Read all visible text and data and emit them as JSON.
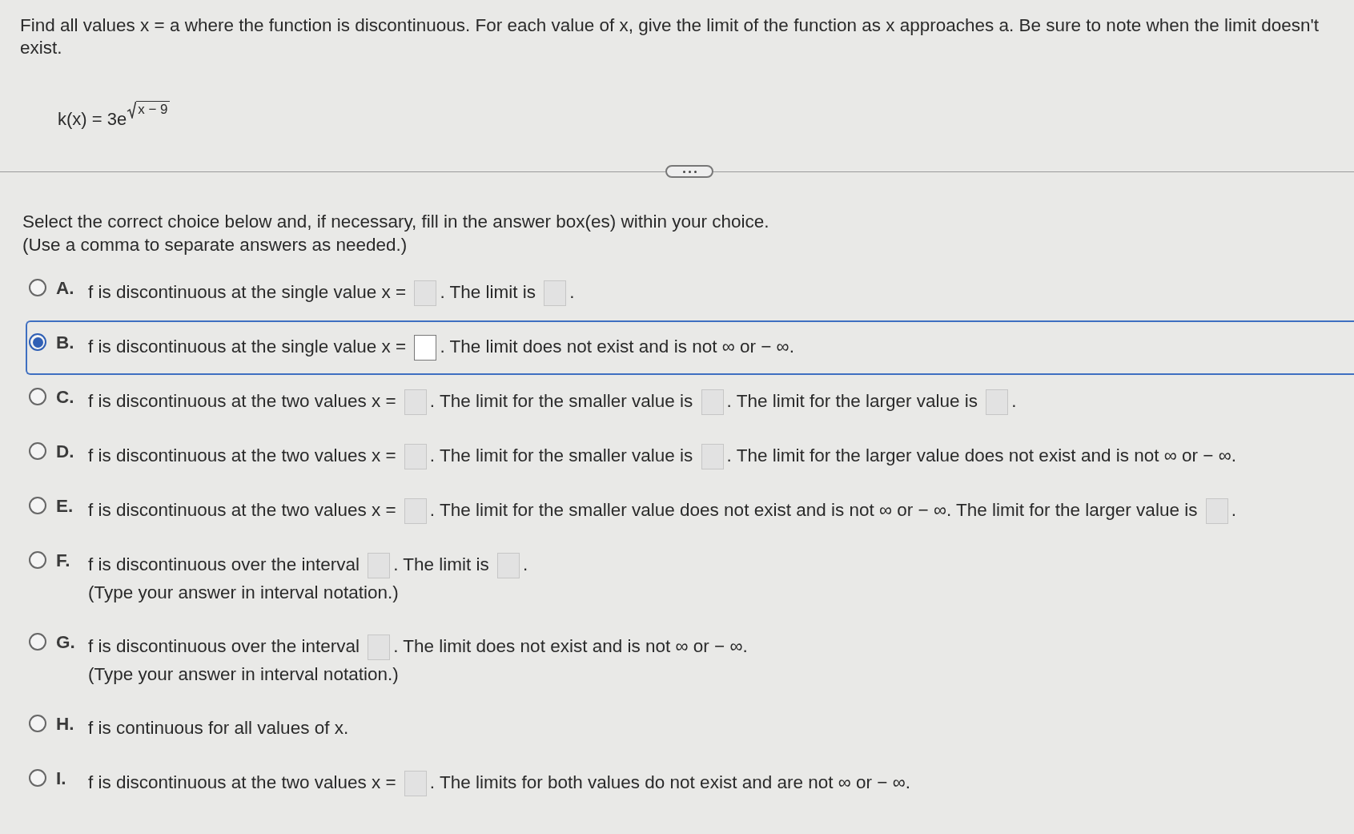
{
  "question": {
    "prompt": "Find all values x = a where the function is discontinuous. For each value of x, give the limit of the function as x approaches a. Be sure to note when the limit doesn't exist.",
    "formula": {
      "lhs": "k(x) = 3e",
      "radicand": "x − 9"
    }
  },
  "instructions": [
    "Select the correct choice below and, if necessary, fill in the answer box(es) within your choice.",
    "(Use a comma to separate answers as needed.)"
  ],
  "choices": [
    {
      "letter": "A.",
      "selected": false,
      "parts": [
        {
          "kind": "text",
          "text": "f is discontinuous at the single value x ="
        },
        {
          "kind": "box"
        },
        {
          "kind": "text",
          "text": ". The limit is"
        },
        {
          "kind": "box"
        },
        {
          "kind": "text",
          "text": "."
        }
      ]
    },
    {
      "letter": "B.",
      "selected": true,
      "parts": [
        {
          "kind": "text",
          "text": "f is discontinuous at the single value x ="
        },
        {
          "kind": "box"
        },
        {
          "kind": "text",
          "text": ". The limit does not exist and is not ∞ or − ∞."
        }
      ]
    },
    {
      "letter": "C.",
      "selected": false,
      "parts": [
        {
          "kind": "text",
          "text": "f is discontinuous at the two values x ="
        },
        {
          "kind": "box"
        },
        {
          "kind": "text",
          "text": ". The limit for the smaller value is"
        },
        {
          "kind": "box"
        },
        {
          "kind": "text",
          "text": ". The limit for the larger value is"
        },
        {
          "kind": "box"
        },
        {
          "kind": "text",
          "text": "."
        }
      ]
    },
    {
      "letter": "D.",
      "selected": false,
      "parts": [
        {
          "kind": "text",
          "text": "f is discontinuous at the two values x ="
        },
        {
          "kind": "box"
        },
        {
          "kind": "text",
          "text": ". The limit for the smaller value is"
        },
        {
          "kind": "box"
        },
        {
          "kind": "text",
          "text": ". The limit for the larger value does not exist and is not ∞ or"
        },
        {
          "kind": "text",
          "text": "− ∞."
        }
      ]
    },
    {
      "letter": "E.",
      "selected": false,
      "parts": [
        {
          "kind": "text",
          "text": "f is discontinuous at the two values x ="
        },
        {
          "kind": "box"
        },
        {
          "kind": "text",
          "text": ". The limit for the smaller value does not exist and is not ∞ or − ∞. The limit for the larger value is"
        },
        {
          "kind": "box"
        },
        {
          "kind": "text",
          "text": "."
        }
      ]
    },
    {
      "letter": "F.",
      "selected": false,
      "parts": [
        {
          "kind": "text",
          "text": "f is discontinuous over the interval"
        },
        {
          "kind": "box"
        },
        {
          "kind": "text",
          "text": ". The limit is"
        },
        {
          "kind": "box"
        },
        {
          "kind": "text",
          "text": "."
        }
      ],
      "note": "(Type your answer in interval notation.)"
    },
    {
      "letter": "G.",
      "selected": false,
      "parts": [
        {
          "kind": "text",
          "text": "f is discontinuous over the interval"
        },
        {
          "kind": "box"
        },
        {
          "kind": "text",
          "text": ". The limit does not exist and is not ∞ or − ∞."
        }
      ],
      "note": "(Type your answer in interval notation.)"
    },
    {
      "letter": "H.",
      "selected": false,
      "parts": [
        {
          "kind": "text",
          "text": "f is continuous for all values of x."
        }
      ]
    },
    {
      "letter": "I.",
      "selected": false,
      "parts": [
        {
          "kind": "text",
          "text": "f is discontinuous at the two values x ="
        },
        {
          "kind": "box"
        },
        {
          "kind": "text",
          "text": ". The limits for both values do not exist and are not ∞ or − ∞."
        }
      ]
    }
  ]
}
